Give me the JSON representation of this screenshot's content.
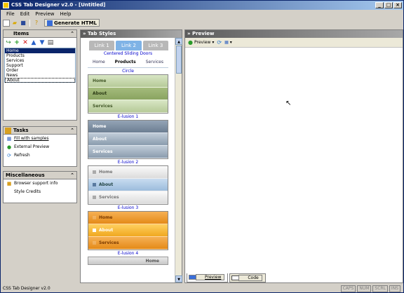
{
  "window": {
    "title": "CSS Tab Designer v2.0 - [Untitled]"
  },
  "menu": [
    "File",
    "Edit",
    "Preview",
    "Help"
  ],
  "toolbar": {
    "generate_label": "Generate HTML"
  },
  "items_panel": {
    "title": "Items",
    "items": [
      "Home",
      "Products",
      "Services",
      "Support",
      "Order",
      "News",
      "About"
    ]
  },
  "tasks_panel": {
    "title": "Tasks",
    "links": [
      "Fill with samples",
      "External Preview",
      "Refresh"
    ]
  },
  "misc_panel": {
    "title": "Miscellaneous",
    "links": [
      "Browser support info",
      "Style Credits"
    ]
  },
  "tab_styles": {
    "title": "» Tab Styles",
    "sliding": {
      "tabs": [
        "Link 1",
        "Link 2",
        "Link 3"
      ],
      "label": "Centered Sliding Doors"
    },
    "circle": {
      "tabs": [
        "Home",
        "Products",
        "Services"
      ],
      "label": "Circle"
    },
    "green": {
      "rows": [
        "Home",
        "About",
        "Services"
      ],
      "label": "E-lusion 1"
    },
    "steel": {
      "rows": [
        "Home",
        "About",
        "Services"
      ],
      "label": "E-lusion 2"
    },
    "silver": {
      "rows": [
        "Home",
        "About",
        "Services"
      ],
      "label": "E-lusion 3"
    },
    "orange": {
      "rows": [
        "Home",
        "About",
        "Services"
      ],
      "label": "E-lusion 4"
    },
    "last": {
      "row": "Home"
    }
  },
  "preview": {
    "title": "» Preview",
    "preview_button": "Preview",
    "tabs": [
      "Preview",
      "Code"
    ]
  },
  "status": {
    "text": "CSS Tab Designer v2.0",
    "indicators": [
      "CAPS",
      "NUM",
      "SCRL",
      "INS"
    ]
  }
}
